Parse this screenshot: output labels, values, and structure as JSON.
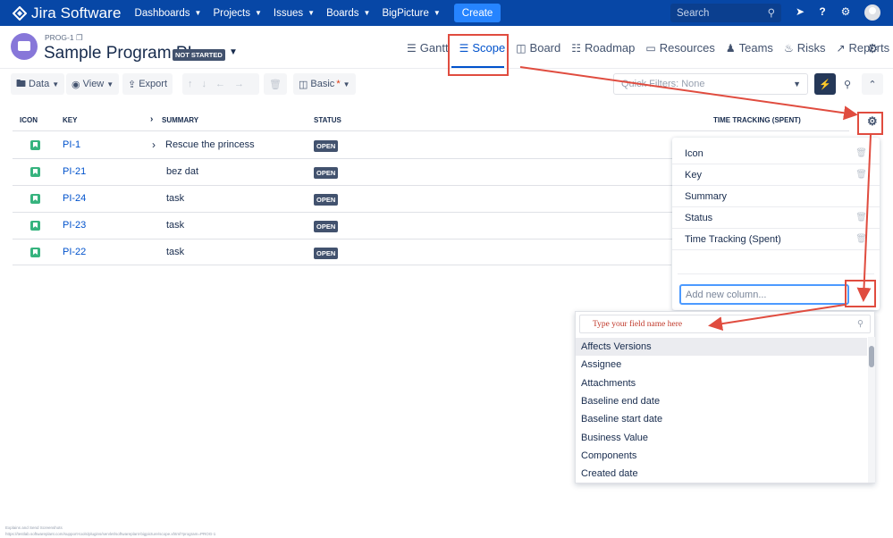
{
  "app": {
    "logo_text": "Jira Software"
  },
  "topnav": {
    "items": [
      {
        "label": "Dashboards"
      },
      {
        "label": "Projects"
      },
      {
        "label": "Issues"
      },
      {
        "label": "Boards"
      },
      {
        "label": "BigPicture"
      }
    ],
    "create_label": "Create",
    "search_placeholder": "Search"
  },
  "program": {
    "id": "PROG-1",
    "title": "Sample Program PI",
    "status_badge": "NOT STARTED"
  },
  "tabs": [
    {
      "label": "Gantt",
      "icon": "gantt-icon"
    },
    {
      "label": "Scope",
      "icon": "list-icon",
      "active": true
    },
    {
      "label": "Board",
      "icon": "board-icon"
    },
    {
      "label": "Roadmap",
      "icon": "roadmap-icon"
    },
    {
      "label": "Resources",
      "icon": "resources-icon"
    },
    {
      "label": "Teams",
      "icon": "teams-icon"
    },
    {
      "label": "Risks",
      "icon": "risks-icon"
    },
    {
      "label": "Reports",
      "icon": "reports-icon"
    }
  ],
  "toolbar": {
    "data_label": "Data",
    "view_label": "View",
    "export_label": "Export",
    "basic_label": "Basic",
    "basic_modified": "*",
    "quick_filters": "Quick Filters: None"
  },
  "grid": {
    "headers": {
      "icon": "ICON",
      "key": "KEY",
      "summary": "SUMMARY",
      "status": "STATUS",
      "time": "TIME TRACKING (SPENT)"
    },
    "rows": [
      {
        "key": "PI-1",
        "summary": "Rescue the princess",
        "status": "OPEN",
        "expandable": true
      },
      {
        "key": "PI-21",
        "summary": "bez dat",
        "status": "OPEN"
      },
      {
        "key": "PI-24",
        "summary": "task",
        "status": "OPEN"
      },
      {
        "key": "PI-23",
        "summary": "task",
        "status": "OPEN"
      },
      {
        "key": "PI-22",
        "summary": "task",
        "status": "OPEN"
      }
    ]
  },
  "column_panel": {
    "columns": [
      {
        "label": "Icon",
        "removable": true
      },
      {
        "label": "Key",
        "removable": true
      },
      {
        "label": "Summary",
        "removable": false
      },
      {
        "label": "Status",
        "removable": true
      },
      {
        "label": "Time Tracking (Spent)",
        "removable": true
      }
    ],
    "add_placeholder": "Add new column..."
  },
  "dropdown": {
    "search_placeholder": "Type your field name here",
    "options": [
      "Affects Versions",
      "Assignee",
      "Attachments",
      "Baseline end date",
      "Baseline start date",
      "Business Value",
      "Components",
      "Created date"
    ],
    "highlighted_index": 0
  },
  "footer": {
    "line1": "Explains and Send Screenshots",
    "line2": "https://testlab.softwareplant.com/support-tools/plugins/servlet/softwareplant-bigpicture/scope.xhtml?program=PROG-1"
  },
  "colors": {
    "topbar": "#0747a6",
    "accent": "#0052cc",
    "annotation": "#e04c3f",
    "issue_icon": "#36b37e"
  }
}
